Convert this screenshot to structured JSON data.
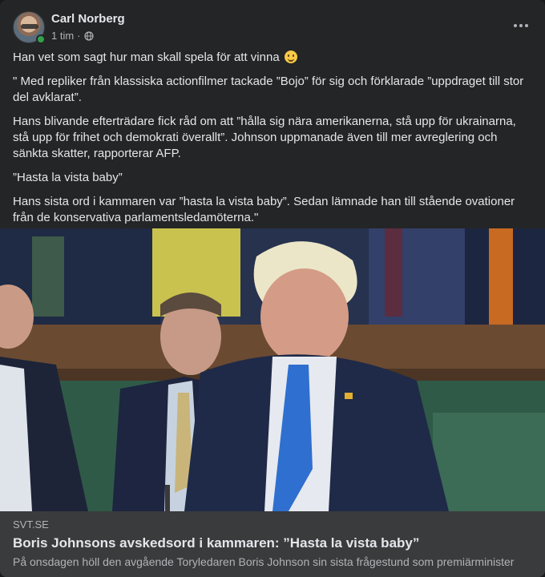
{
  "post": {
    "author": "Carl Norberg",
    "timestamp": "1 tim",
    "separator": "·",
    "privacy_icon": "globe-icon",
    "more_icon": "more-horizontal-icon",
    "paragraphs": [
      "Han vet som sagt hur man skall spela för att vinna",
      "\" Med repliker från klassiska actionfilmer tackade ”Bojo” för sig och förklarade ”uppdraget till stor del avklarat”.",
      "Hans blivande efterträdare fick råd om att ”hålla sig nära amerikanerna, stå upp för ukrainarna, stå upp för frihet och demokrati överallt”. Johnson uppmanade även till mer avreglering och sänkta skatter, rapporterar AFP.",
      "”Hasta la vista baby”",
      "Hans sista ord i kammaren var ”hasta la vista baby”. Sedan lämnade han till stående ovationer från de konservativa parlamentsledamöterna.\""
    ],
    "emoji": "slightly-smiling-face"
  },
  "link": {
    "domain": "SVT.SE",
    "title": "Boris Johnsons avskedsord i kammaren: ”Hasta la vista baby”",
    "description": "På onsdagen höll den avgående Toryledaren Boris Johnson sin sista frågestund som premiärminister"
  },
  "colors": {
    "card_bg": "#242526",
    "link_bg": "#3a3b3c",
    "text_primary": "#e4e6eb",
    "text_secondary": "#b0b3b8",
    "online": "#31a24c"
  }
}
